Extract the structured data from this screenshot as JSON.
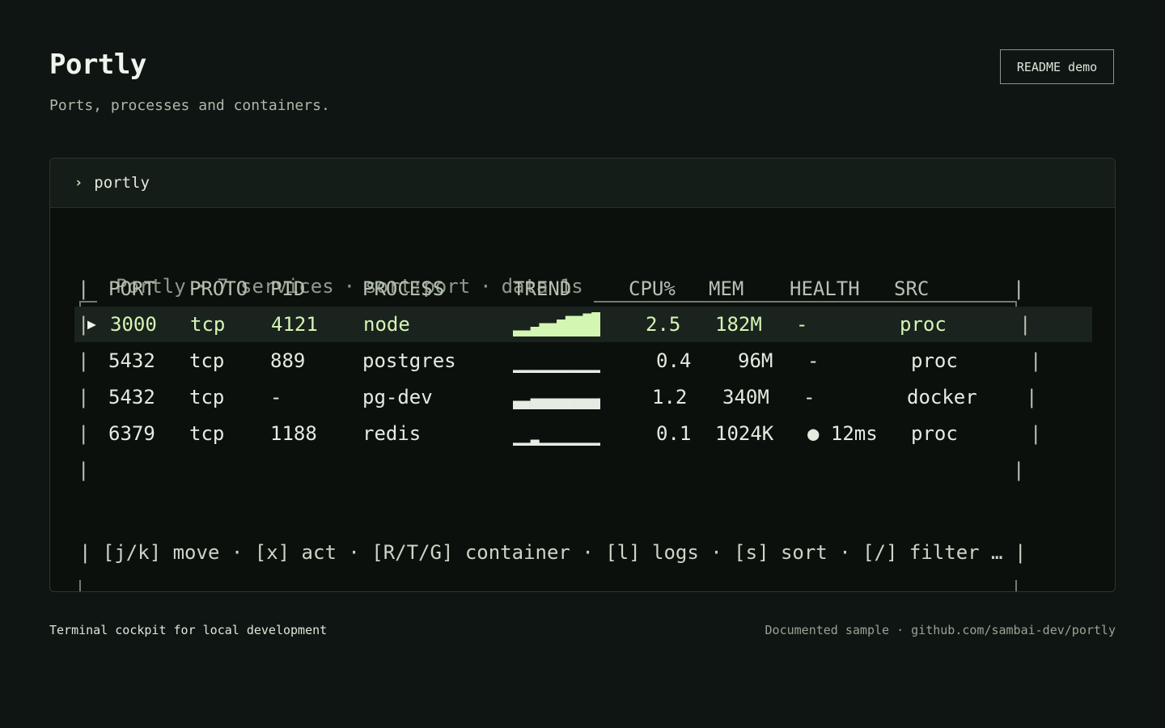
{
  "header": {
    "title": "Portly",
    "subtitle": "Ports, processes and containers.",
    "readme_button": "README demo"
  },
  "window": {
    "prompt_symbol": "›",
    "command": "portly"
  },
  "panel": {
    "app_name": "Portly",
    "service_count": "7 services",
    "sort": "sort:port",
    "refresh": "data 1s",
    "separator": "·"
  },
  "table": {
    "columns": [
      "PORT",
      "PROTO",
      "PID",
      "PROCESS",
      "TREND",
      "CPU%",
      "MEM",
      "HEALTH",
      "SRC"
    ],
    "rows": [
      {
        "port": "3000",
        "proto": "tcp",
        "pid": "4121",
        "process": "node",
        "cpu": "2.5",
        "mem": "182M",
        "health": "-",
        "src": "proc",
        "selected": true,
        "trend": [
          0.25,
          0.25,
          0.4,
          0.55,
          0.55,
          0.7,
          0.85,
          0.85,
          0.95,
          1.0
        ]
      },
      {
        "port": "5432",
        "proto": "tcp",
        "pid": "889",
        "process": "postgres",
        "cpu": "0.4",
        "mem": "96M",
        "health": "-",
        "src": "proc",
        "selected": false,
        "trend": [
          0.12,
          0.12,
          0.12,
          0.12,
          0.12,
          0.12,
          0.12,
          0.12,
          0.12,
          0.12
        ]
      },
      {
        "port": "5432",
        "proto": "tcp",
        "pid": "-",
        "process": "pg-dev",
        "cpu": "1.2",
        "mem": "340M",
        "health": "-",
        "src": "docker",
        "selected": false,
        "trend": [
          0.35,
          0.35,
          0.45,
          0.45,
          0.45,
          0.45,
          0.45,
          0.45,
          0.45,
          0.45
        ]
      },
      {
        "port": "6379",
        "proto": "tcp",
        "pid": "1188",
        "process": "redis",
        "cpu": "0.1",
        "mem": "1024K",
        "health": "● 12ms",
        "src": "proc",
        "selected": false,
        "trend": [
          0.12,
          0.12,
          0.25,
          0.12,
          0.12,
          0.12,
          0.12,
          0.12,
          0.12,
          0.12
        ]
      }
    ]
  },
  "keybinds": "[j/k] move · [x] act · [R/T/G] container · [l] logs · [s] sort · [/] filter …",
  "footer": {
    "left": "Terminal cockpit for local development",
    "right": "Documented sample · github.com/sambai-dev/portly"
  },
  "colors": {
    "background": "#0f1512",
    "terminal_bg": "#0b100d",
    "highlight_text": "#d6f5b6",
    "spark_selected": "#d3f7b3",
    "spark_normal": "#e6ebe3"
  }
}
